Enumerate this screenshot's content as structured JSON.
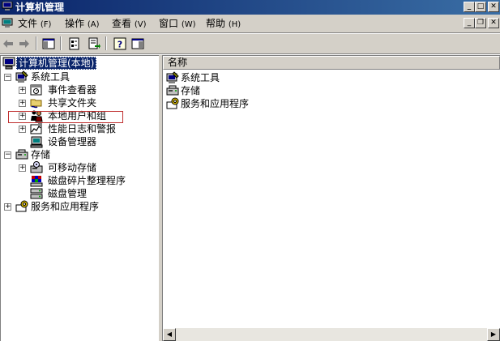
{
  "window": {
    "title": "计算机管理",
    "controls": {
      "minimize": "_",
      "maximize": "□",
      "close": "✕"
    }
  },
  "menubar": {
    "items": [
      {
        "label": "文件",
        "accel": "(F)"
      },
      {
        "label": "操作",
        "accel": "(A)"
      },
      {
        "label": "查看",
        "accel": "(V)"
      },
      {
        "label": "窗口",
        "accel": "(W)"
      },
      {
        "label": "帮助",
        "accel": "(H)"
      }
    ],
    "mdi_controls": {
      "minimize": "_",
      "restore": "❐",
      "close": "✕"
    }
  },
  "toolbar": {
    "buttons": [
      "back-icon",
      "forward-icon",
      "show-hide-tree-icon",
      "properties-icon",
      "export-list-icon",
      "help-icon",
      "show-hide-action-pane-icon"
    ]
  },
  "tree": {
    "root": {
      "label": "计算机管理(本地)"
    },
    "nodes": [
      {
        "label": "系统工具",
        "expander": "−",
        "level": 1
      },
      {
        "label": "事件查看器",
        "expander": "+",
        "level": 2
      },
      {
        "label": "共享文件夹",
        "expander": "+",
        "level": 2
      },
      {
        "label": "本地用户和组",
        "expander": "+",
        "level": 2,
        "highlighted": true
      },
      {
        "label": "性能日志和警报",
        "expander": "+",
        "level": 2
      },
      {
        "label": "设备管理器",
        "expander": "",
        "level": 2
      },
      {
        "label": "存储",
        "expander": "−",
        "level": 1
      },
      {
        "label": "可移动存储",
        "expander": "+",
        "level": 2
      },
      {
        "label": "磁盘碎片整理程序",
        "expander": "",
        "level": 2
      },
      {
        "label": "磁盘管理",
        "expander": "",
        "level": 2
      },
      {
        "label": "服务和应用程序",
        "expander": "+",
        "level": 1
      }
    ]
  },
  "list": {
    "column_header": "名称",
    "items": [
      {
        "label": "系统工具"
      },
      {
        "label": "存储"
      },
      {
        "label": "服务和应用程序"
      }
    ]
  },
  "scrollbar": {
    "left_arrow": "◀",
    "right_arrow": "▶"
  },
  "colors": {
    "title_bar": "#0a246a",
    "selection": "#0a246a",
    "highlight_box": "#c03030",
    "face": "#d4d0c8"
  }
}
